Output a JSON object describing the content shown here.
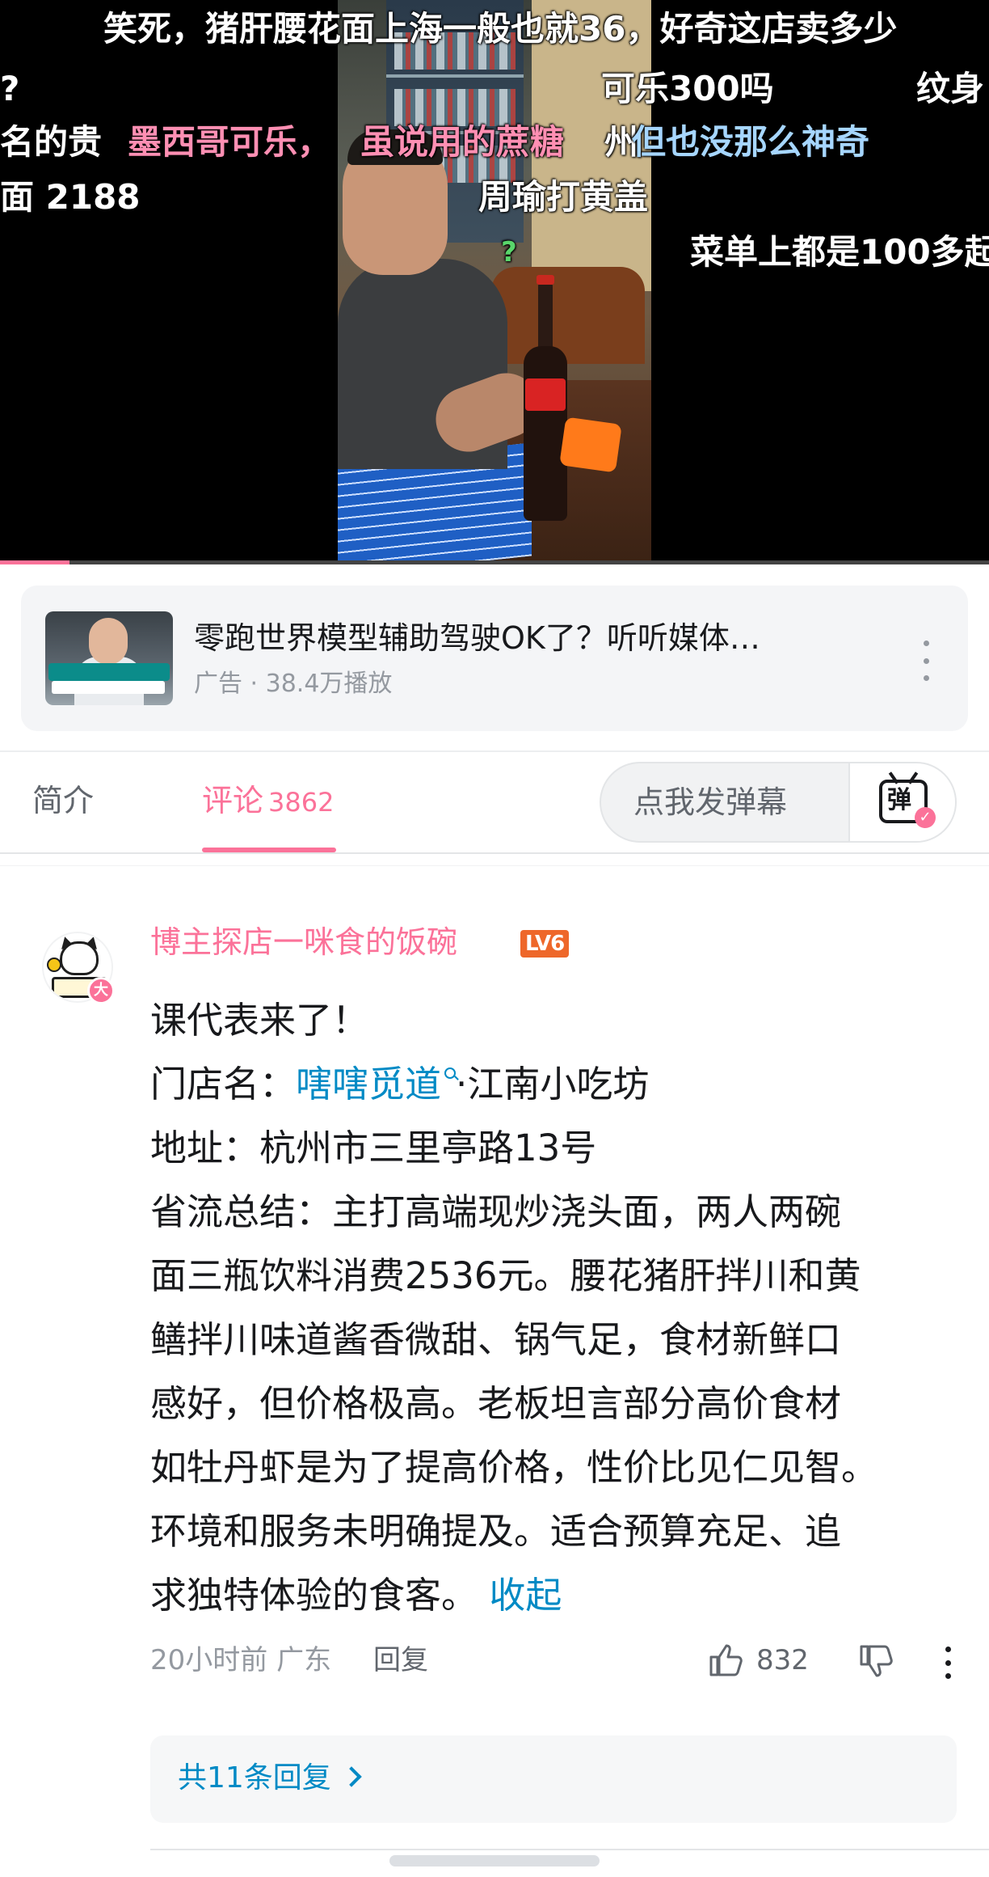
{
  "player": {
    "danmaku": [
      {
        "text": "笑死，猪肝腰花面上海一般也就36，好奇这店卖多少",
        "style": "white"
      },
      {
        "text": "?",
        "style": "white"
      },
      {
        "text": "可乐300吗",
        "style": "white"
      },
      {
        "text": "纹身",
        "style": "white"
      },
      {
        "text": "名的贵",
        "style": "white"
      },
      {
        "text": "墨西哥可乐，",
        "style": "pink"
      },
      {
        "text": "虽说用的蔗糖",
        "style": "pink"
      },
      {
        "text": "州",
        "style": "white"
      },
      {
        "text": "但也没那么神奇",
        "style": "blue"
      },
      {
        "text": "面  2188",
        "style": "white"
      },
      {
        "text": "周瑜打黄盖",
        "style": "white"
      },
      {
        "text": "菜单上都是100多起",
        "style": "white"
      },
      {
        "text": "?",
        "style": "white"
      }
    ],
    "progress": 0.07
  },
  "ad": {
    "title": "零跑世界模型辅助驾驶OK了？听听媒体…",
    "meta": "广告 · 38.4万播放",
    "more_icon": "more-vertical-icon"
  },
  "tabs": {
    "intro_label": "简介",
    "comments_label": "评论",
    "comments_count": "3862",
    "danmu_placeholder": "点我发弹幕",
    "danmu_button_char": "弹"
  },
  "comment": {
    "username": "博主探店一咪食的饭碗",
    "level": "LV6",
    "avatar_badge": "大",
    "lines": {
      "l1": "课代表来了！",
      "l2_prefix": "门店名：",
      "l2_link": "嗐嗐觅道",
      "l2_suffix": "·江南小吃坊",
      "l3": "地址：杭州市三里亭路13号",
      "l4": "省流总结：主打高端现炒浇头面，两人两碗",
      "l5": "面三瓶饮料消费2536元。腰花猪肝拌川和黄",
      "l6": "鳝拌川味道酱香微甜、锅气足，食材新鲜口",
      "l7": "感好，但价格极高。老板坦言部分高价食材",
      "l8": "如牡丹虾是为了提高价格，性价比见仁见智。",
      "l9": "环境和服务未明确提及。适合预算充足、追",
      "l10_text": "求独特体验的食客。",
      "l10_link": "收起"
    },
    "time": "20小时前",
    "location": "广东",
    "reply_label": "回复",
    "likes": "832",
    "replies_label": "共11条回复"
  },
  "colors": {
    "brand_pink": "#fb7299",
    "link_blue": "#008ac5",
    "level_orange": "#ee672a"
  }
}
